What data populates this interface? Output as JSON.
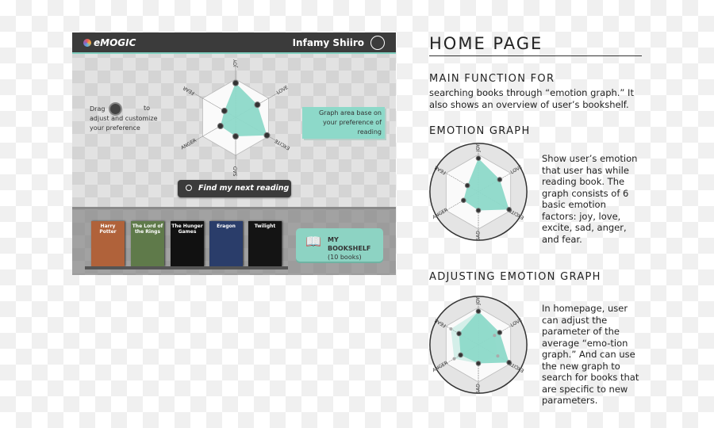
{
  "app": {
    "logo": "eMOGIC",
    "user_name": "Infamy Shiiro",
    "drag_hint": {
      "pre": "Drag",
      "post": "to",
      "rest": "adjust and customize your preference"
    },
    "graph_note": "Graph area base on your preference of reading",
    "search_button": "Find my next reading",
    "books": [
      {
        "title": "Harry Potter",
        "color": "#b0623a"
      },
      {
        "title": "The Lord of the Rings",
        "color": "#5f7a4a"
      },
      {
        "title": "The Hunger Games",
        "color": "#111111"
      },
      {
        "title": "Eragon",
        "color": "#2a3d6a"
      },
      {
        "title": "Twilight",
        "color": "#141414"
      }
    ],
    "bookshelf": {
      "label": "MY BOOKSHELF",
      "count": "(10 books)"
    },
    "emotions": [
      "JOY",
      "LOVE",
      "EXCITE",
      "SAD",
      "ANGER",
      "FEAR"
    ],
    "values": [
      0.9,
      0.66,
      0.95,
      0.5,
      0.46,
      0.34
    ],
    "accent": "#8dd9c9"
  },
  "doc": {
    "title": "HOME PAGE",
    "main_heading": "MAIN FUNCTION FOR",
    "main_text": "searching books through “emotion graph.” It also shows an overview of user’s bookshelf.",
    "graph_heading": "EMOTION GRAPH",
    "graph_text": "Show user’s emotion that user has while reading book. The graph consists of 6 basic emotion factors: joy, love, excite, sad, anger, and fear.",
    "adjust_heading": "ADJUSTING EMOTION GRAPH",
    "adjust_text": "In homepage, user can adjust the parameter of the average “emo-tion graph.” And can use the new graph to search for books that are specific to new parameters.",
    "adjust_values": [
      0.9,
      0.66,
      0.95,
      0.5,
      0.55,
      0.6
    ],
    "adjust_prev_values": [
      0.9,
      0.5,
      0.6,
      0.5,
      0.75,
      0.85
    ]
  }
}
